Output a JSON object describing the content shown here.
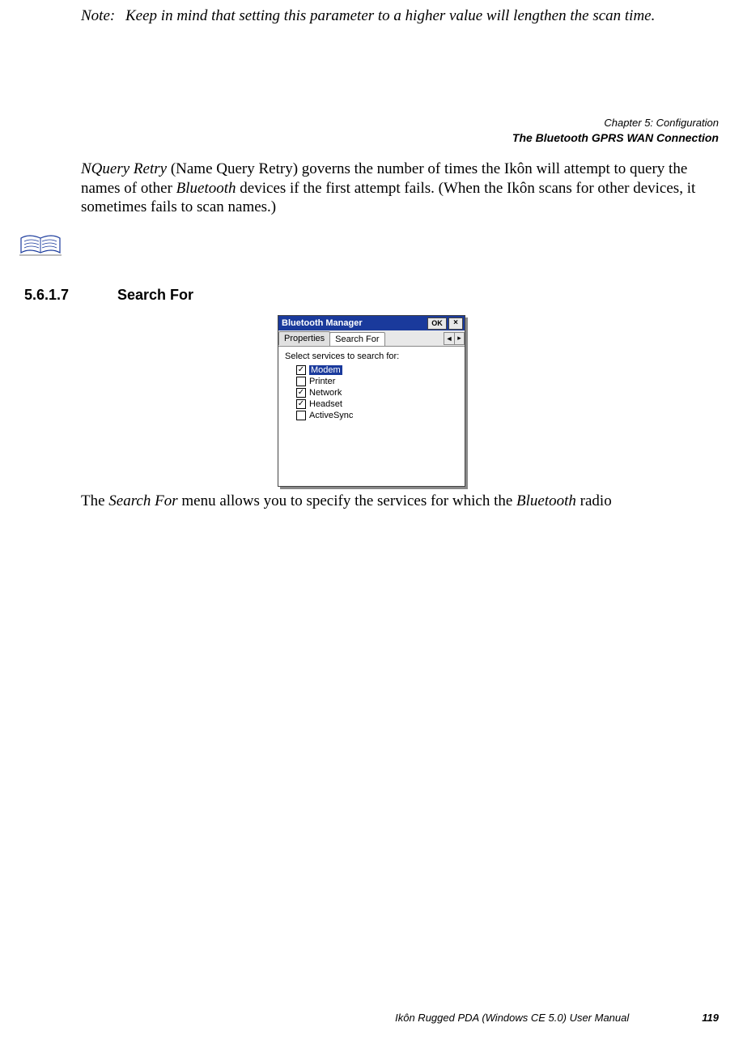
{
  "note": {
    "label": "Note:",
    "text": "Keep in mind that setting this parameter to a higher value will lengthen the scan time."
  },
  "header": {
    "chapter": "Chapter 5:  Configuration",
    "section": "The Bluetooth GPRS WAN Connection"
  },
  "paragraph1": {
    "italic_lead": "NQuery Retry",
    "part1": " (Name Query Retry) governs the number of times the Ikôn will attempt to query the names of other ",
    "italic_mid": "Bluetooth",
    "part2": " devices if the first attempt fails. (When the Ikôn scans for other devices, it sometimes fails to scan names.)"
  },
  "heading": {
    "number": "5.6.1.7",
    "title": "Search For"
  },
  "window": {
    "title": "Bluetooth Manager",
    "ok": "OK",
    "close": "×",
    "tabs": {
      "properties": "Properties",
      "searchfor": "Search For",
      "scroll_left": "◄",
      "scroll_right": "▸"
    },
    "body_label": "Select services to search for:",
    "items": {
      "modem": {
        "label": "Modem",
        "checked": true,
        "selected": true
      },
      "printer": {
        "label": "Printer",
        "checked": false,
        "selected": false
      },
      "network": {
        "label": "Network",
        "checked": true,
        "selected": false
      },
      "headset": {
        "label": "Headset",
        "checked": true,
        "selected": false
      },
      "activesync": {
        "label": "ActiveSync",
        "checked": false,
        "selected": false
      }
    }
  },
  "caption": {
    "pre": "The ",
    "em1": "Search For",
    "mid": " menu allows you to specify the services for which the ",
    "em2": "Bluetooth",
    "post": " radio"
  },
  "footer": {
    "title": "Ikôn Rugged PDA (Windows CE 5.0) User Manual",
    "page": "119"
  }
}
